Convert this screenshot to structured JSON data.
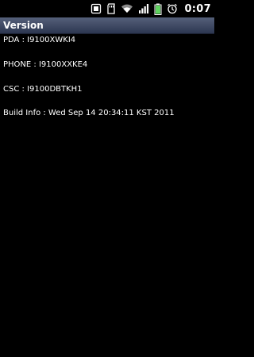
{
  "status_bar": {
    "time": "0:07",
    "icons": [
      "usb-debugging-icon",
      "sd-card-icon",
      "wifi-icon",
      "signal-icon",
      "battery-icon",
      "alarm-icon"
    ],
    "battery_color": "#5fd35f"
  },
  "title_bar": {
    "title": "Version",
    "color": "#3d4760"
  },
  "info": {
    "pda": "PDA : I9100XWKI4",
    "phone": "PHONE : I9100XXKE4",
    "csc": "CSC : I9100DBTKH1",
    "build": "Build Info : Wed Sep 14 20:34:11 KST 2011"
  }
}
